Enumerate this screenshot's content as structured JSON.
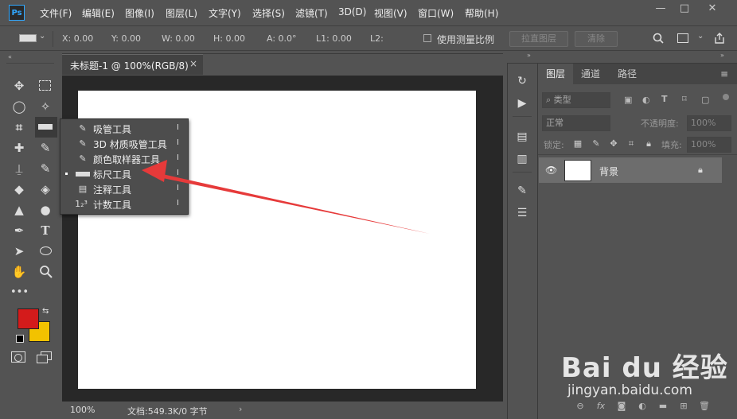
{
  "app": {
    "logo": "Ps"
  },
  "menu": [
    "文件(F)",
    "编辑(E)",
    "图像(I)",
    "图层(L)",
    "文字(Y)",
    "选择(S)",
    "滤镜(T)",
    "3D(D)",
    "视图(V)",
    "窗口(W)",
    "帮助(H)"
  ],
  "window_controls": {
    "minimize": "—",
    "maximize": "□",
    "close": "✕"
  },
  "options": {
    "x": "X: 0.00",
    "y": "Y: 0.00",
    "w": "W: 0.00",
    "h": "H: 0.00",
    "angle": "A: 0.0°",
    "l1": "L1: 0.00",
    "l2": "L2:",
    "use_measure_scale": "使用测量比例",
    "straighten_button": "拉直图层",
    "clear_button": "清除"
  },
  "document": {
    "tab_title": "未标题-1 @ 100%(RGB/8)",
    "tab_close": "×",
    "zoom": "100%",
    "doc_info": "文档:549.3K/0 字节",
    "status_arrow": "›"
  },
  "flyout": [
    {
      "icon": "eyedropper-icon",
      "glyph": "✎",
      "label": "吸管工具",
      "key": "I",
      "selected": false
    },
    {
      "icon": "3d-material-eyedropper-icon",
      "glyph": "✎",
      "label": "3D 材质吸管工具",
      "key": "I",
      "selected": false
    },
    {
      "icon": "color-sampler-icon",
      "glyph": "✎",
      "label": "颜色取样器工具",
      "key": "I",
      "selected": false
    },
    {
      "icon": "ruler-icon",
      "glyph": "▬",
      "label": "标尺工具",
      "key": "I",
      "selected": true
    },
    {
      "icon": "note-icon",
      "glyph": "▤",
      "label": "注释工具",
      "key": "I",
      "selected": false
    },
    {
      "icon": "count-icon",
      "glyph": "1₂³",
      "label": "计数工具",
      "key": "I",
      "selected": false
    }
  ],
  "colors": {
    "foreground": "#d41b1b",
    "background": "#f2c200",
    "arrow": "#e63a3a"
  },
  "layers_panel": {
    "tabs": [
      "图层",
      "通道",
      "路径"
    ],
    "filter_kind": "类型",
    "blend_mode": "正常",
    "opacity_label": "不透明度:",
    "opacity_value": "100%",
    "lock_label": "锁定:",
    "fill_label": "填充:",
    "fill_value": "100%",
    "layer_name": "背景"
  },
  "watermark": {
    "brand": "Bai du 经验",
    "url": "jingyan.baidu.com"
  }
}
